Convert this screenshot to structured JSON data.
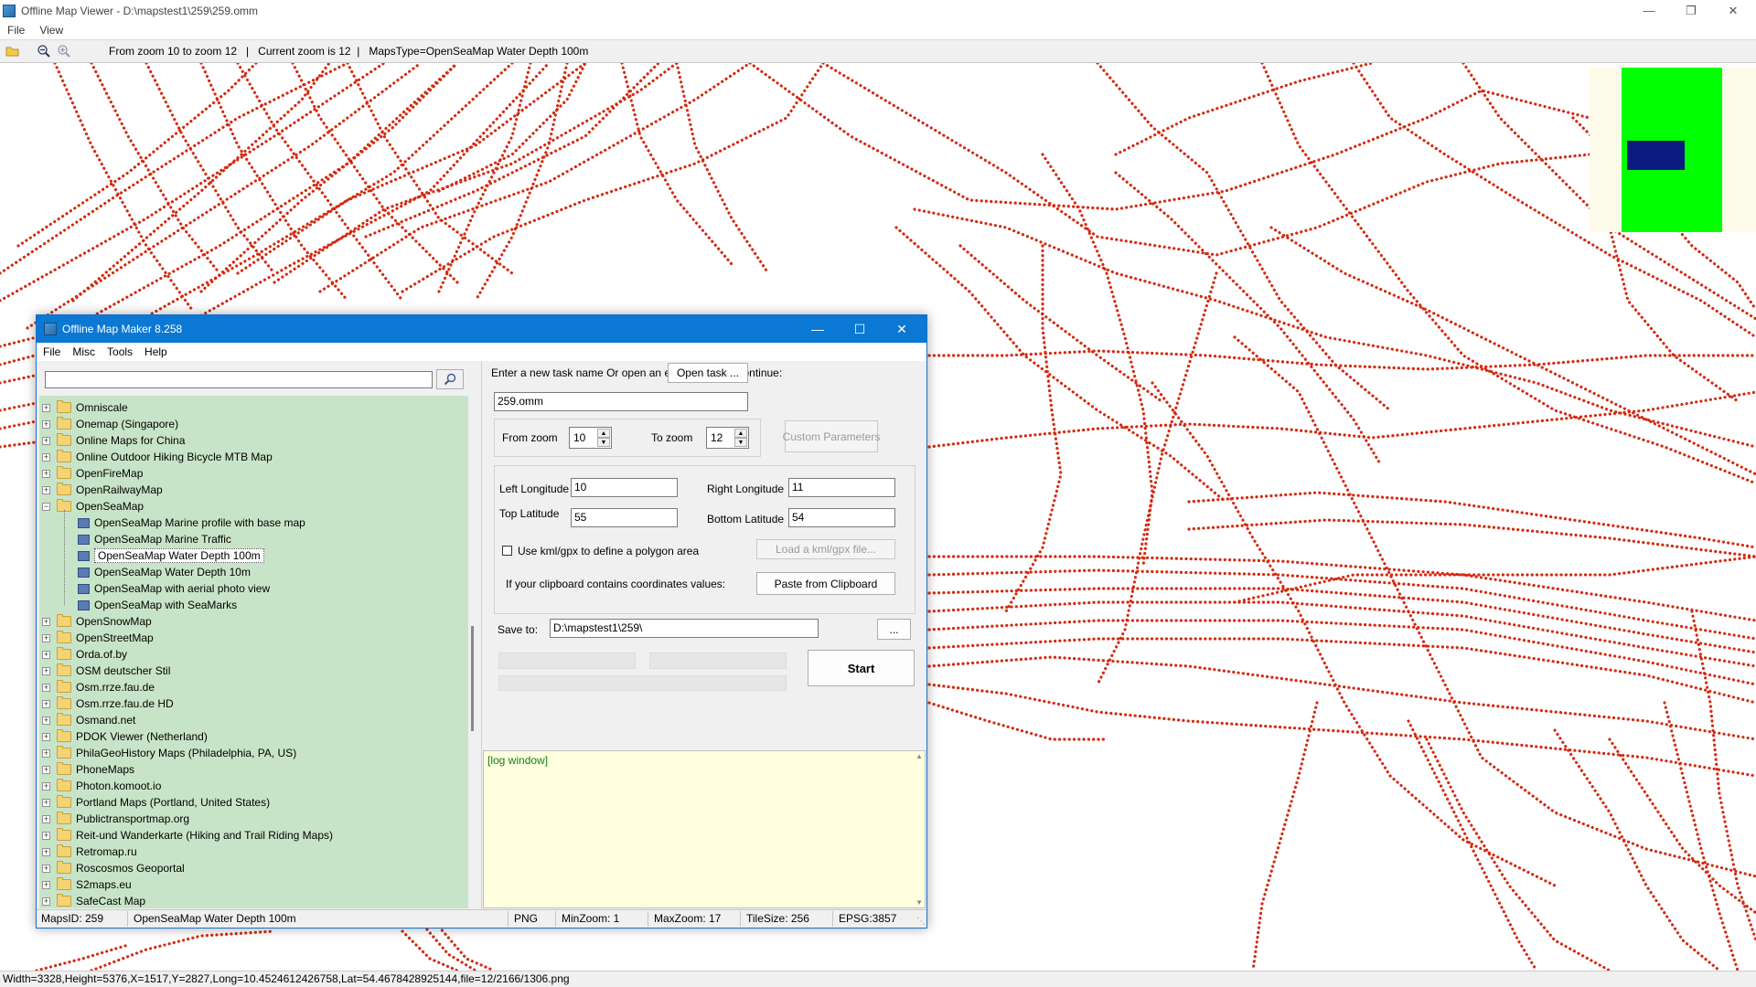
{
  "viewer": {
    "title": "Offline Map Viewer - D:\\mapstest1\\259\\259.omm",
    "menu": [
      "File",
      "View"
    ],
    "toolbar_status": "From zoom 10 to zoom 12   |   Current zoom is 12  |   MapsType=OpenSeaMap Water Depth 100m",
    "status_text": "Width=3328,Height=5376,X=1517,Y=2827,Long=10.4524612426758,Lat=54.4678428925144,file=12/2166/1306.png"
  },
  "dialog": {
    "title": "Offline Map Maker 8.258",
    "menu": [
      "File",
      "Misc",
      "Tools",
      "Help"
    ],
    "search_value": "",
    "tree": [
      {
        "label": "Omniscale",
        "level": 0,
        "expanded": false
      },
      {
        "label": "Onemap (Singapore)",
        "level": 0,
        "expanded": false
      },
      {
        "label": "Online Maps for China",
        "level": 0,
        "expanded": false
      },
      {
        "label": "Online Outdoor Hiking Bicycle MTB Map",
        "level": 0,
        "expanded": false
      },
      {
        "label": "OpenFireMap",
        "level": 0,
        "expanded": false
      },
      {
        "label": "OpenRailwayMap",
        "level": 0,
        "expanded": false
      },
      {
        "label": "OpenSeaMap",
        "level": 0,
        "expanded": true
      },
      {
        "label": "OpenSeaMap Marine profile with base map",
        "level": 1
      },
      {
        "label": "OpenSeaMap Marine Traffic",
        "level": 1
      },
      {
        "label": "OpenSeaMap Water Depth 100m",
        "level": 1,
        "selected": true
      },
      {
        "label": "OpenSeaMap Water Depth 10m",
        "level": 1
      },
      {
        "label": "OpenSeaMap with aerial photo view",
        "level": 1
      },
      {
        "label": "OpenSeaMap with SeaMarks",
        "level": 1
      },
      {
        "label": "OpenSnowMap",
        "level": 0,
        "expanded": false
      },
      {
        "label": "OpenStreetMap",
        "level": 0,
        "expanded": false
      },
      {
        "label": "Orda.of.by",
        "level": 0,
        "expanded": false
      },
      {
        "label": "OSM deutscher Stil",
        "level": 0,
        "expanded": false
      },
      {
        "label": "Osm.rrze.fau.de",
        "level": 0,
        "expanded": false
      },
      {
        "label": "Osm.rrze.fau.de HD",
        "level": 0,
        "expanded": false
      },
      {
        "label": "Osmand.net",
        "level": 0,
        "expanded": false
      },
      {
        "label": "PDOK Viewer (Netherland)",
        "level": 0,
        "expanded": false
      },
      {
        "label": "PhilaGeoHistory Maps (Philadelphia, PA, US)",
        "level": 0,
        "expanded": false
      },
      {
        "label": "PhoneMaps",
        "level": 0,
        "expanded": false
      },
      {
        "label": "Photon.komoot.io",
        "level": 0,
        "expanded": false
      },
      {
        "label": "Portland Maps (Portland, United States)",
        "level": 0,
        "expanded": false
      },
      {
        "label": "Publictransportmap.org",
        "level": 0,
        "expanded": false
      },
      {
        "label": "Reit-und Wanderkarte (Hiking and Trail Riding Maps)",
        "level": 0,
        "expanded": false
      },
      {
        "label": "Retromap.ru",
        "level": 0,
        "expanded": false
      },
      {
        "label": "Roscosmos Geoportal",
        "level": 0,
        "expanded": false
      },
      {
        "label": "S2maps.eu",
        "level": 0,
        "expanded": false
      },
      {
        "label": "SafeCast Map",
        "level": 0,
        "expanded": false
      }
    ],
    "task_prompt": "Enter a new task name Or open an existed task to continue:",
    "open_task_label": "Open task ...",
    "task_name": "259.omm",
    "from_zoom_label": "From zoom",
    "from_zoom": "10",
    "to_zoom_label": "To zoom",
    "to_zoom": "12",
    "custom_params_label": "Custom Parameters",
    "left_lon_label": "Left Longitude",
    "left_lon": "10",
    "right_lon_label": "Right Longitude",
    "right_lon": "11",
    "top_lat_label": "Top Latitude",
    "top_lat": "55",
    "bottom_lat_label": "Bottom Latitude",
    "bottom_lat": "54",
    "kml_check_label": "Use kml/gpx to define a polygon area",
    "kml_checked": false,
    "load_kml_label": "Load a kml/gpx file...",
    "clipboard_prompt": "If your clipboard contains coordinates values:",
    "paste_label": "Paste from Clipboard",
    "save_to_label": "Save to:",
    "save_to": "D:\\mapstest1\\259\\",
    "browse_label": "...",
    "start_label": "Start",
    "log_text": "[log window]",
    "status": {
      "maps_id": "MapsID: 259",
      "map_name": "OpenSeaMap Water Depth 100m",
      "format": "PNG",
      "min_zoom": "MinZoom: 1",
      "max_zoom": "MaxZoom: 17",
      "tile_size": "TileSize: 256",
      "epsg": "EPSG:3857"
    }
  },
  "colors": {
    "track": "#d42a10",
    "minimap_green": "#00ff00",
    "minimap_viewport": "#0a1a80",
    "tree_bg": "#c8e4c8",
    "dialog_title_bg": "#0b78d4",
    "log_bg": "#ffffe0"
  }
}
